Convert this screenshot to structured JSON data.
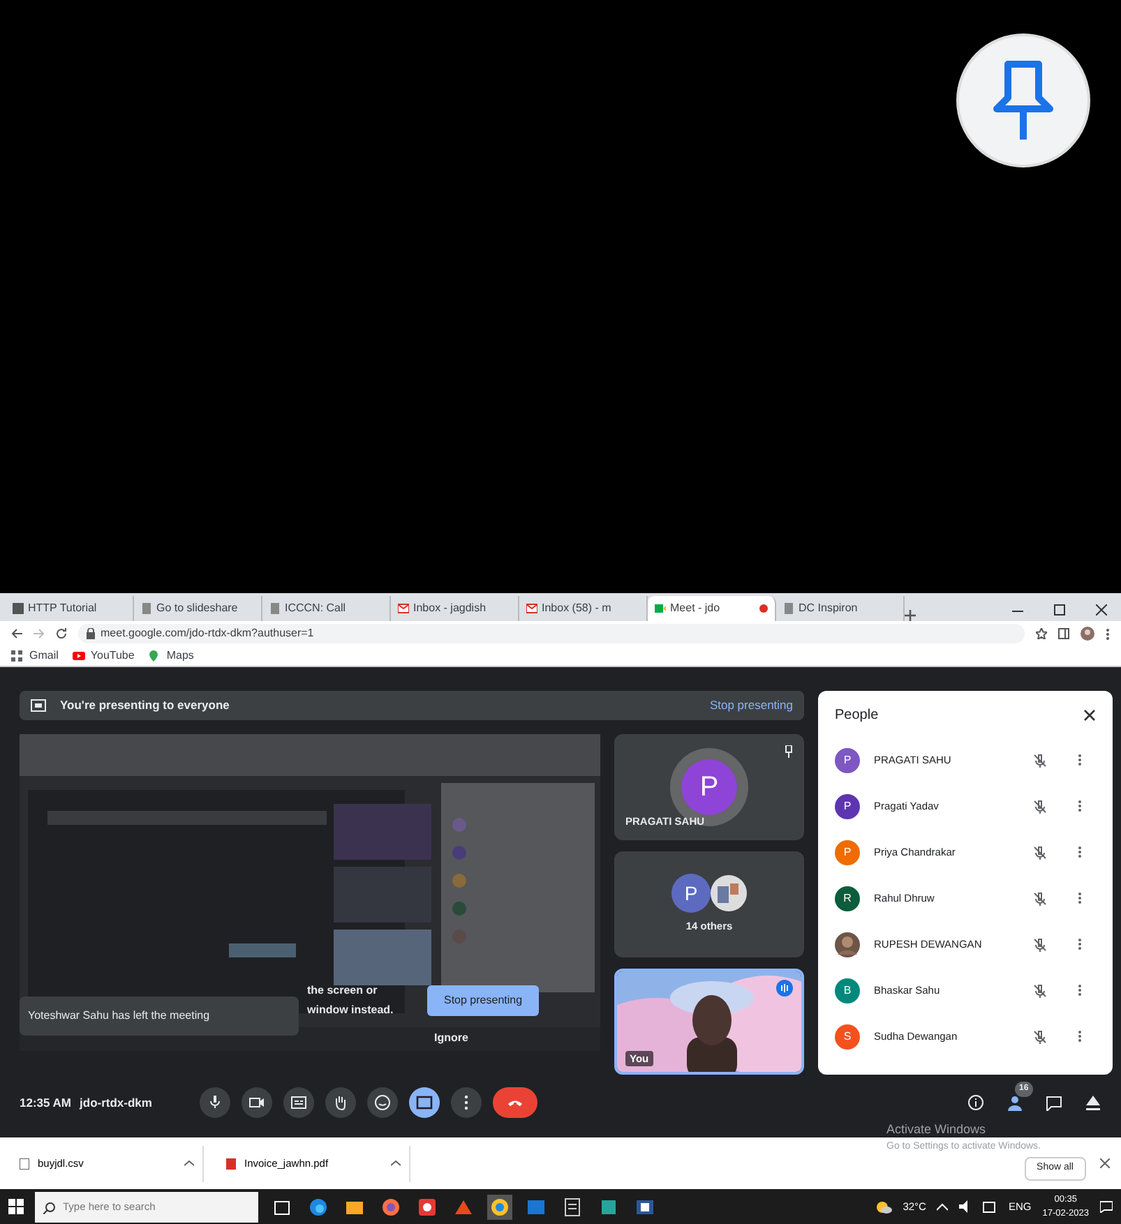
{
  "tabs": [
    {
      "title": "HTTP Tutorial",
      "selected": false,
      "kind": "letter"
    },
    {
      "title": "Go to slideshare",
      "selected": false,
      "kind": "page"
    },
    {
      "title": "ICCCN: Call",
      "selected": false,
      "kind": "page"
    },
    {
      "title": "Inbox - jagdish",
      "selected": false,
      "kind": "mail"
    },
    {
      "title": "Inbox (58) - m",
      "selected": false,
      "kind": "mail"
    },
    {
      "title": "Meet - jdo",
      "selected": true,
      "kind": "meet",
      "recording": true
    },
    {
      "title": "DC Inspiron",
      "selected": false,
      "kind": "page"
    }
  ],
  "address": "meet.google.com/jdo-rtdx-dkm?authuser=1",
  "bookmarks": [
    {
      "label": "Gmail",
      "kind": "grid"
    },
    {
      "label": "YouTube",
      "kind": "youtube"
    },
    {
      "label": "Maps",
      "kind": "maps"
    }
  ],
  "meet": {
    "presenting_banner": {
      "text": "You're presenting to everyone",
      "action": "Stop presenting"
    },
    "tiles": [
      {
        "kind": "avatar",
        "initial": "P",
        "name": "PRAGATI SAHU",
        "color": "#8e44d6"
      },
      {
        "kind": "group",
        "initial": "P",
        "name": "14 others",
        "color": "#5c6bc0"
      },
      {
        "kind": "video",
        "name": "You"
      }
    ],
    "toast": "Yoteshwar Sahu has left the meeting",
    "dialog": {
      "lines": [
        "the screen or",
        "window instead."
      ],
      "primary": "Stop presenting",
      "secondary": "Ignore"
    },
    "people": {
      "title": "People",
      "rows": [
        {
          "initial": "P",
          "name": "PRAGATI SAHU",
          "color": "#7e57c2",
          "kind": "letter"
        },
        {
          "initial": "P",
          "name": "Pragati Yadav",
          "color": "#5e35b1",
          "kind": "letter"
        },
        {
          "initial": "P",
          "name": "Priya Chandrakar",
          "color": "#ef6c00",
          "kind": "letter"
        },
        {
          "initial": "R",
          "name": "Rahul Dhruw",
          "color": "#0b5d3b",
          "kind": "letter"
        },
        {
          "name": "RUPESH DEWANGAN"
        },
        {
          "initial": "B",
          "name": "Bhaskar Sahu",
          "color": "#00897b",
          "kind": "letter"
        },
        {
          "initial": "S",
          "name": "Sudha Dewangan",
          "color": "#f4511e",
          "kind": "letter"
        }
      ]
    },
    "time": "12:35 AM",
    "code": "jdo-rtdx-dkm",
    "controls": [
      {
        "kind": "mic",
        "on": false
      },
      {
        "kind": "camera",
        "on": false
      },
      {
        "kind": "captions",
        "on": false
      },
      {
        "kind": "hand",
        "on": false
      },
      {
        "kind": "emoji",
        "on": false
      },
      {
        "kind": "present",
        "on": true
      },
      {
        "kind": "more",
        "on": false
      },
      {
        "kind": "hangup"
      }
    ],
    "people_count": "16"
  },
  "downloads": [
    {
      "file": "buyjdl.csv",
      "kind": "csv"
    },
    {
      "file": "Invoice_jawhn.pdf",
      "kind": "pdf"
    }
  ],
  "activation": {
    "title": "Activate Windows",
    "hint": "Go to Settings to activate Windows."
  },
  "downloads_action": "Show all",
  "taskbar": {
    "placeholder": "Type here to search",
    "temperature": "32°C",
    "language": "ENG",
    "time": "00:35",
    "date": "17-02-2023"
  }
}
